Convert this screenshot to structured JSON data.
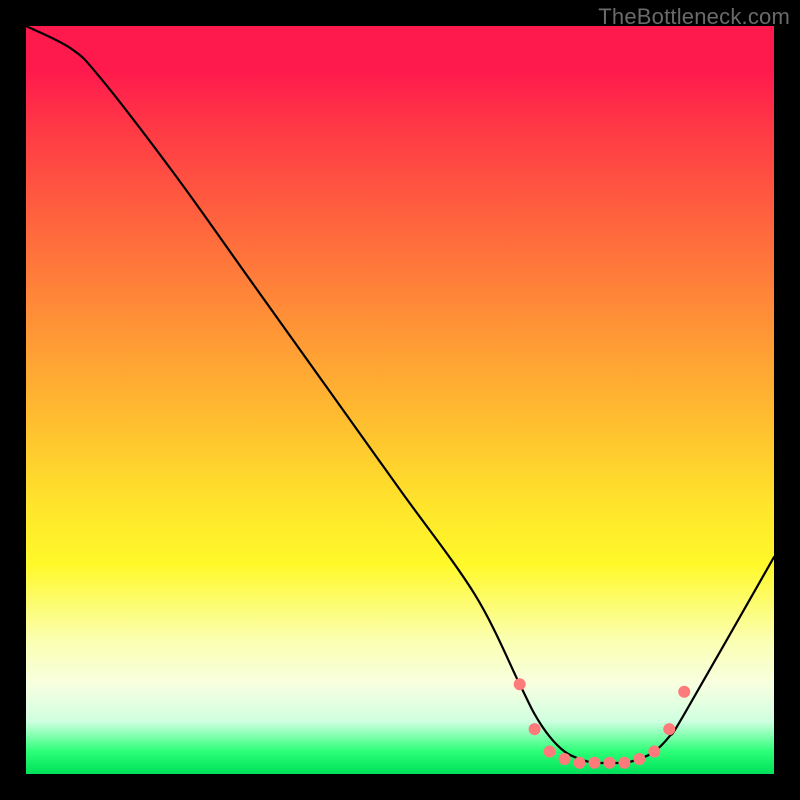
{
  "watermark": "TheBottleneck.com",
  "chart_data": {
    "type": "line",
    "title": "",
    "xlabel": "",
    "ylabel": "",
    "xlim": [
      0,
      100
    ],
    "ylim": [
      0,
      100
    ],
    "series": [
      {
        "name": "curve",
        "x": [
          0,
          6,
          10,
          20,
          30,
          40,
          50,
          60,
          66,
          68,
          70,
          72,
          74,
          76,
          78,
          80,
          82,
          84,
          86,
          88,
          100
        ],
        "values": [
          100,
          97,
          93,
          80,
          66,
          52,
          38,
          24,
          12,
          8,
          5,
          3,
          2,
          1.5,
          1.5,
          1.5,
          2,
          3,
          5,
          8,
          29
        ]
      }
    ],
    "markers": {
      "name": "dots",
      "x": [
        66,
        68,
        70,
        72,
        74,
        76,
        78,
        80,
        82,
        84,
        86,
        88
      ],
      "values": [
        12,
        6,
        3,
        2,
        1.5,
        1.5,
        1.5,
        1.5,
        2,
        3,
        6,
        11
      ],
      "color": "#ff7a7a",
      "radius": 6
    },
    "gradient_stops": [
      {
        "offset": 0,
        "color": "#ff1a4d"
      },
      {
        "offset": 6,
        "color": "#ff1a4d"
      },
      {
        "offset": 14,
        "color": "#ff3a45"
      },
      {
        "offset": 28,
        "color": "#ff6a3d"
      },
      {
        "offset": 42,
        "color": "#ff9a35"
      },
      {
        "offset": 54,
        "color": "#ffc22f"
      },
      {
        "offset": 64,
        "color": "#ffe42b"
      },
      {
        "offset": 72,
        "color": "#fff92a"
      },
      {
        "offset": 82,
        "color": "#fbffb0"
      },
      {
        "offset": 88,
        "color": "#f7ffe0"
      },
      {
        "offset": 93,
        "color": "#cfffe0"
      },
      {
        "offset": 97,
        "color": "#2bff77"
      },
      {
        "offset": 100,
        "color": "#00e05a"
      }
    ]
  }
}
